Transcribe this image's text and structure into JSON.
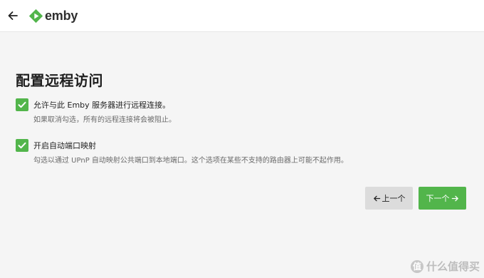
{
  "header": {
    "back_icon": "arrow-left-icon",
    "logo_text": "emby",
    "logo_color": "#52b54b"
  },
  "page": {
    "title": "配置远程访问"
  },
  "options": [
    {
      "label": "允许与此 Emby 服务器进行远程连接。",
      "help": "如果取消勾选，所有的远程连接将会被阻止。",
      "checked": true
    },
    {
      "label": "开启自动端口映射",
      "help": "勾选以通过 UPnP 自动映射公共端口到本地端口。这个选项在某些不支持的路由器上可能不起作用。",
      "checked": true
    }
  ],
  "buttons": {
    "prev_label": "上一个",
    "next_label": "下一个",
    "prev_icon": "arrow-left-icon",
    "next_icon": "arrow-right-icon"
  },
  "watermark": {
    "badge": "值",
    "text": "什么值得买"
  },
  "colors": {
    "accent": "#52b54b",
    "background": "#f5f5f5",
    "header": "#ffffff",
    "secondary_button": "#dcdcdc"
  }
}
